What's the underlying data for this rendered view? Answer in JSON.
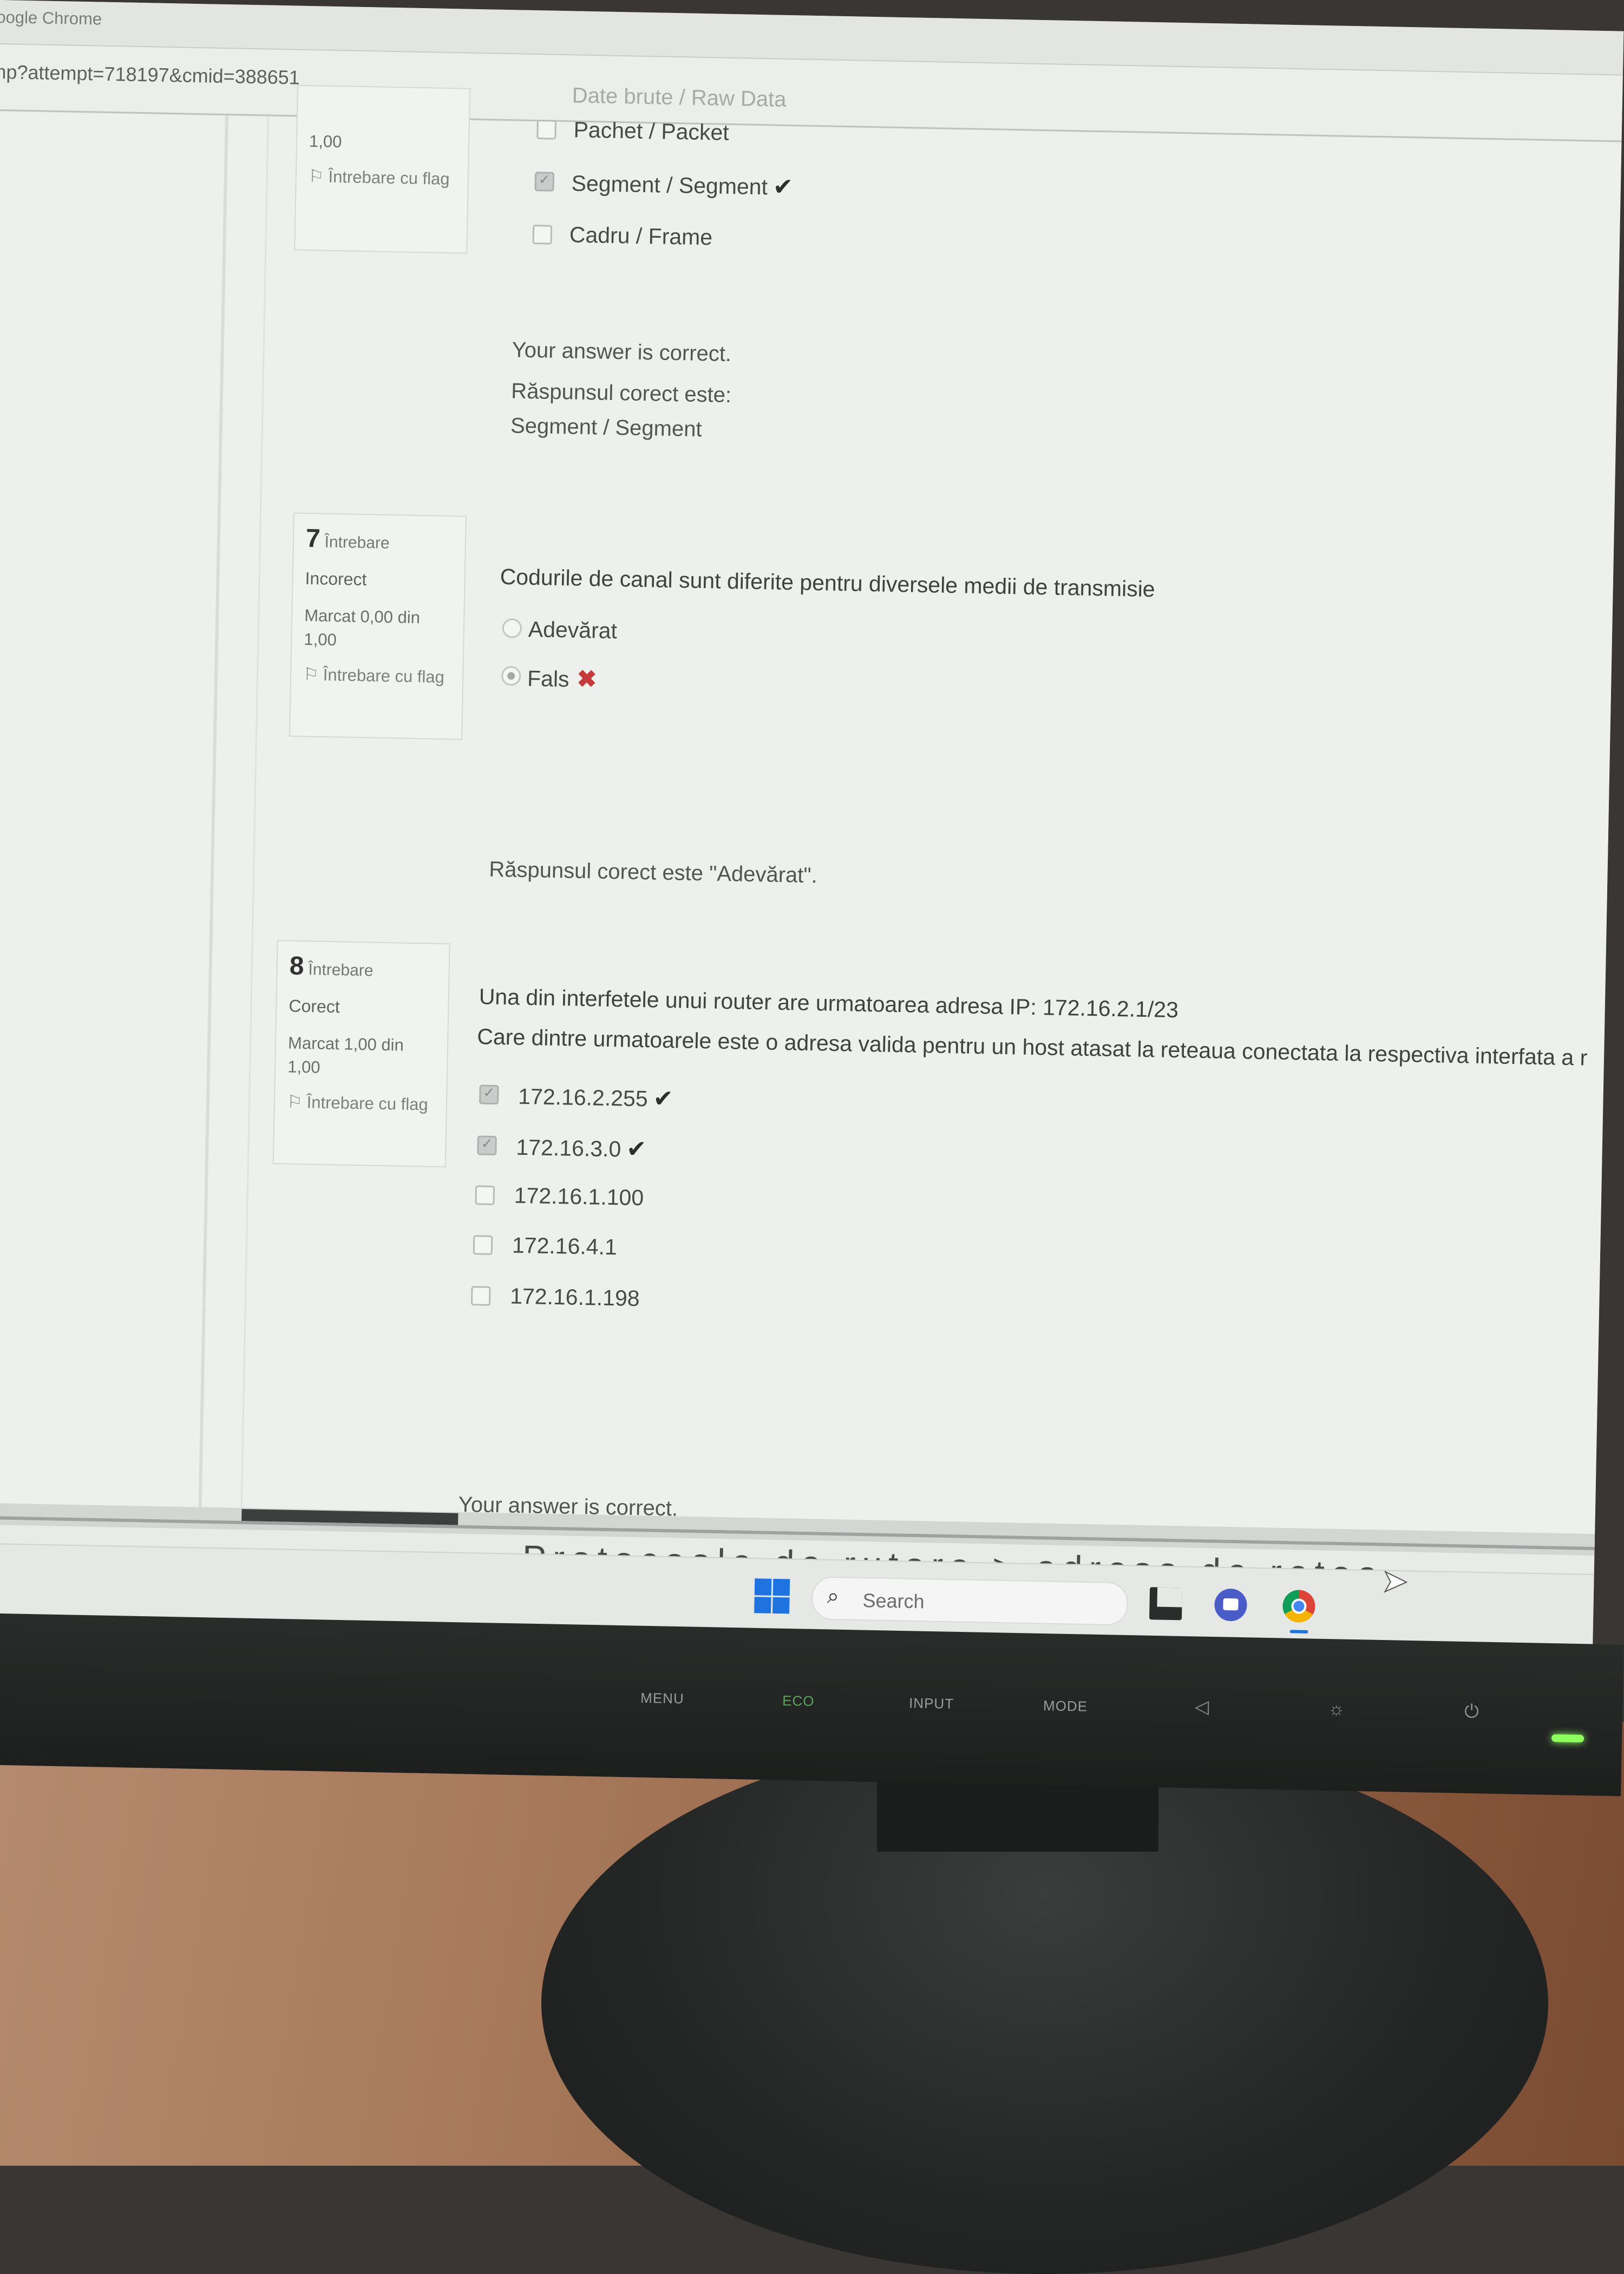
{
  "browser": {
    "title": "oogle Chrome",
    "url": "hp?attempt=718197&cmid=388651"
  },
  "q6": {
    "grade_tail": "1,00",
    "flag": "Întrebare cu flag",
    "options": [
      {
        "label": "Date brute / Raw Data",
        "checked": false,
        "mark": ""
      },
      {
        "label": "Pachet / Packet",
        "checked": false,
        "mark": ""
      },
      {
        "label": "Segment / Segment",
        "checked": true,
        "mark": "✔"
      },
      {
        "label": "Cadru / Frame",
        "checked": false,
        "mark": ""
      }
    ],
    "feedback": "Your answer is correct.",
    "correct_label": "Răspunsul corect este:",
    "correct_value": "Segment / Segment"
  },
  "q7": {
    "number": "7",
    "word": "Întrebare",
    "state": "Incorect",
    "grade": "Marcat 0,00 din 1,00",
    "flag": "Întrebare cu flag",
    "text": "Codurile de canal sunt diferite pentru diversele medii de transmisie",
    "options": [
      {
        "label": "Adevărat",
        "checked": false,
        "mark": ""
      },
      {
        "label": "Fals",
        "checked": true,
        "mark": "✖"
      }
    ],
    "correct": "Răspunsul corect este \"Adevărat\"."
  },
  "q8": {
    "number": "8",
    "word": "Întrebare",
    "state": "Corect",
    "grade": "Marcat 1,00 din 1,00",
    "flag": "Întrebare cu flag",
    "text1": "Una din interfetele unui router are urmatoarea adresa IP: 172.16.2.1/23",
    "text2": "Care dintre urmatoarele este o adresa valida pentru un host atasat la reteaua conectata la respectiva interfata a r",
    "options": [
      {
        "label": "172.16.2.255",
        "checked": true,
        "mark": "✔"
      },
      {
        "label": "172.16.3.0",
        "checked": true,
        "mark": "✔"
      },
      {
        "label": "172.16.1.100",
        "checked": false,
        "mark": ""
      },
      {
        "label": "172.16.4.1",
        "checked": false,
        "mark": ""
      },
      {
        "label": "172.16.1.198",
        "checked": false,
        "mark": ""
      }
    ],
    "feedback_cut": "Your answer is correct."
  },
  "overlay_text": "Protocoale de rutare > adresa de retea",
  "taskbar": {
    "search_placeholder": "Search",
    "icons": [
      "windows-start-icon",
      "search-icon",
      "file-explorer-icon",
      "meet-icon",
      "chrome-icon"
    ]
  },
  "monitor": {
    "buttons": [
      "MENU",
      "ECO",
      "INPUT",
      "MODE"
    ],
    "symbols": [
      "volume-icon",
      "brightness-icon",
      "power-icon"
    ]
  }
}
